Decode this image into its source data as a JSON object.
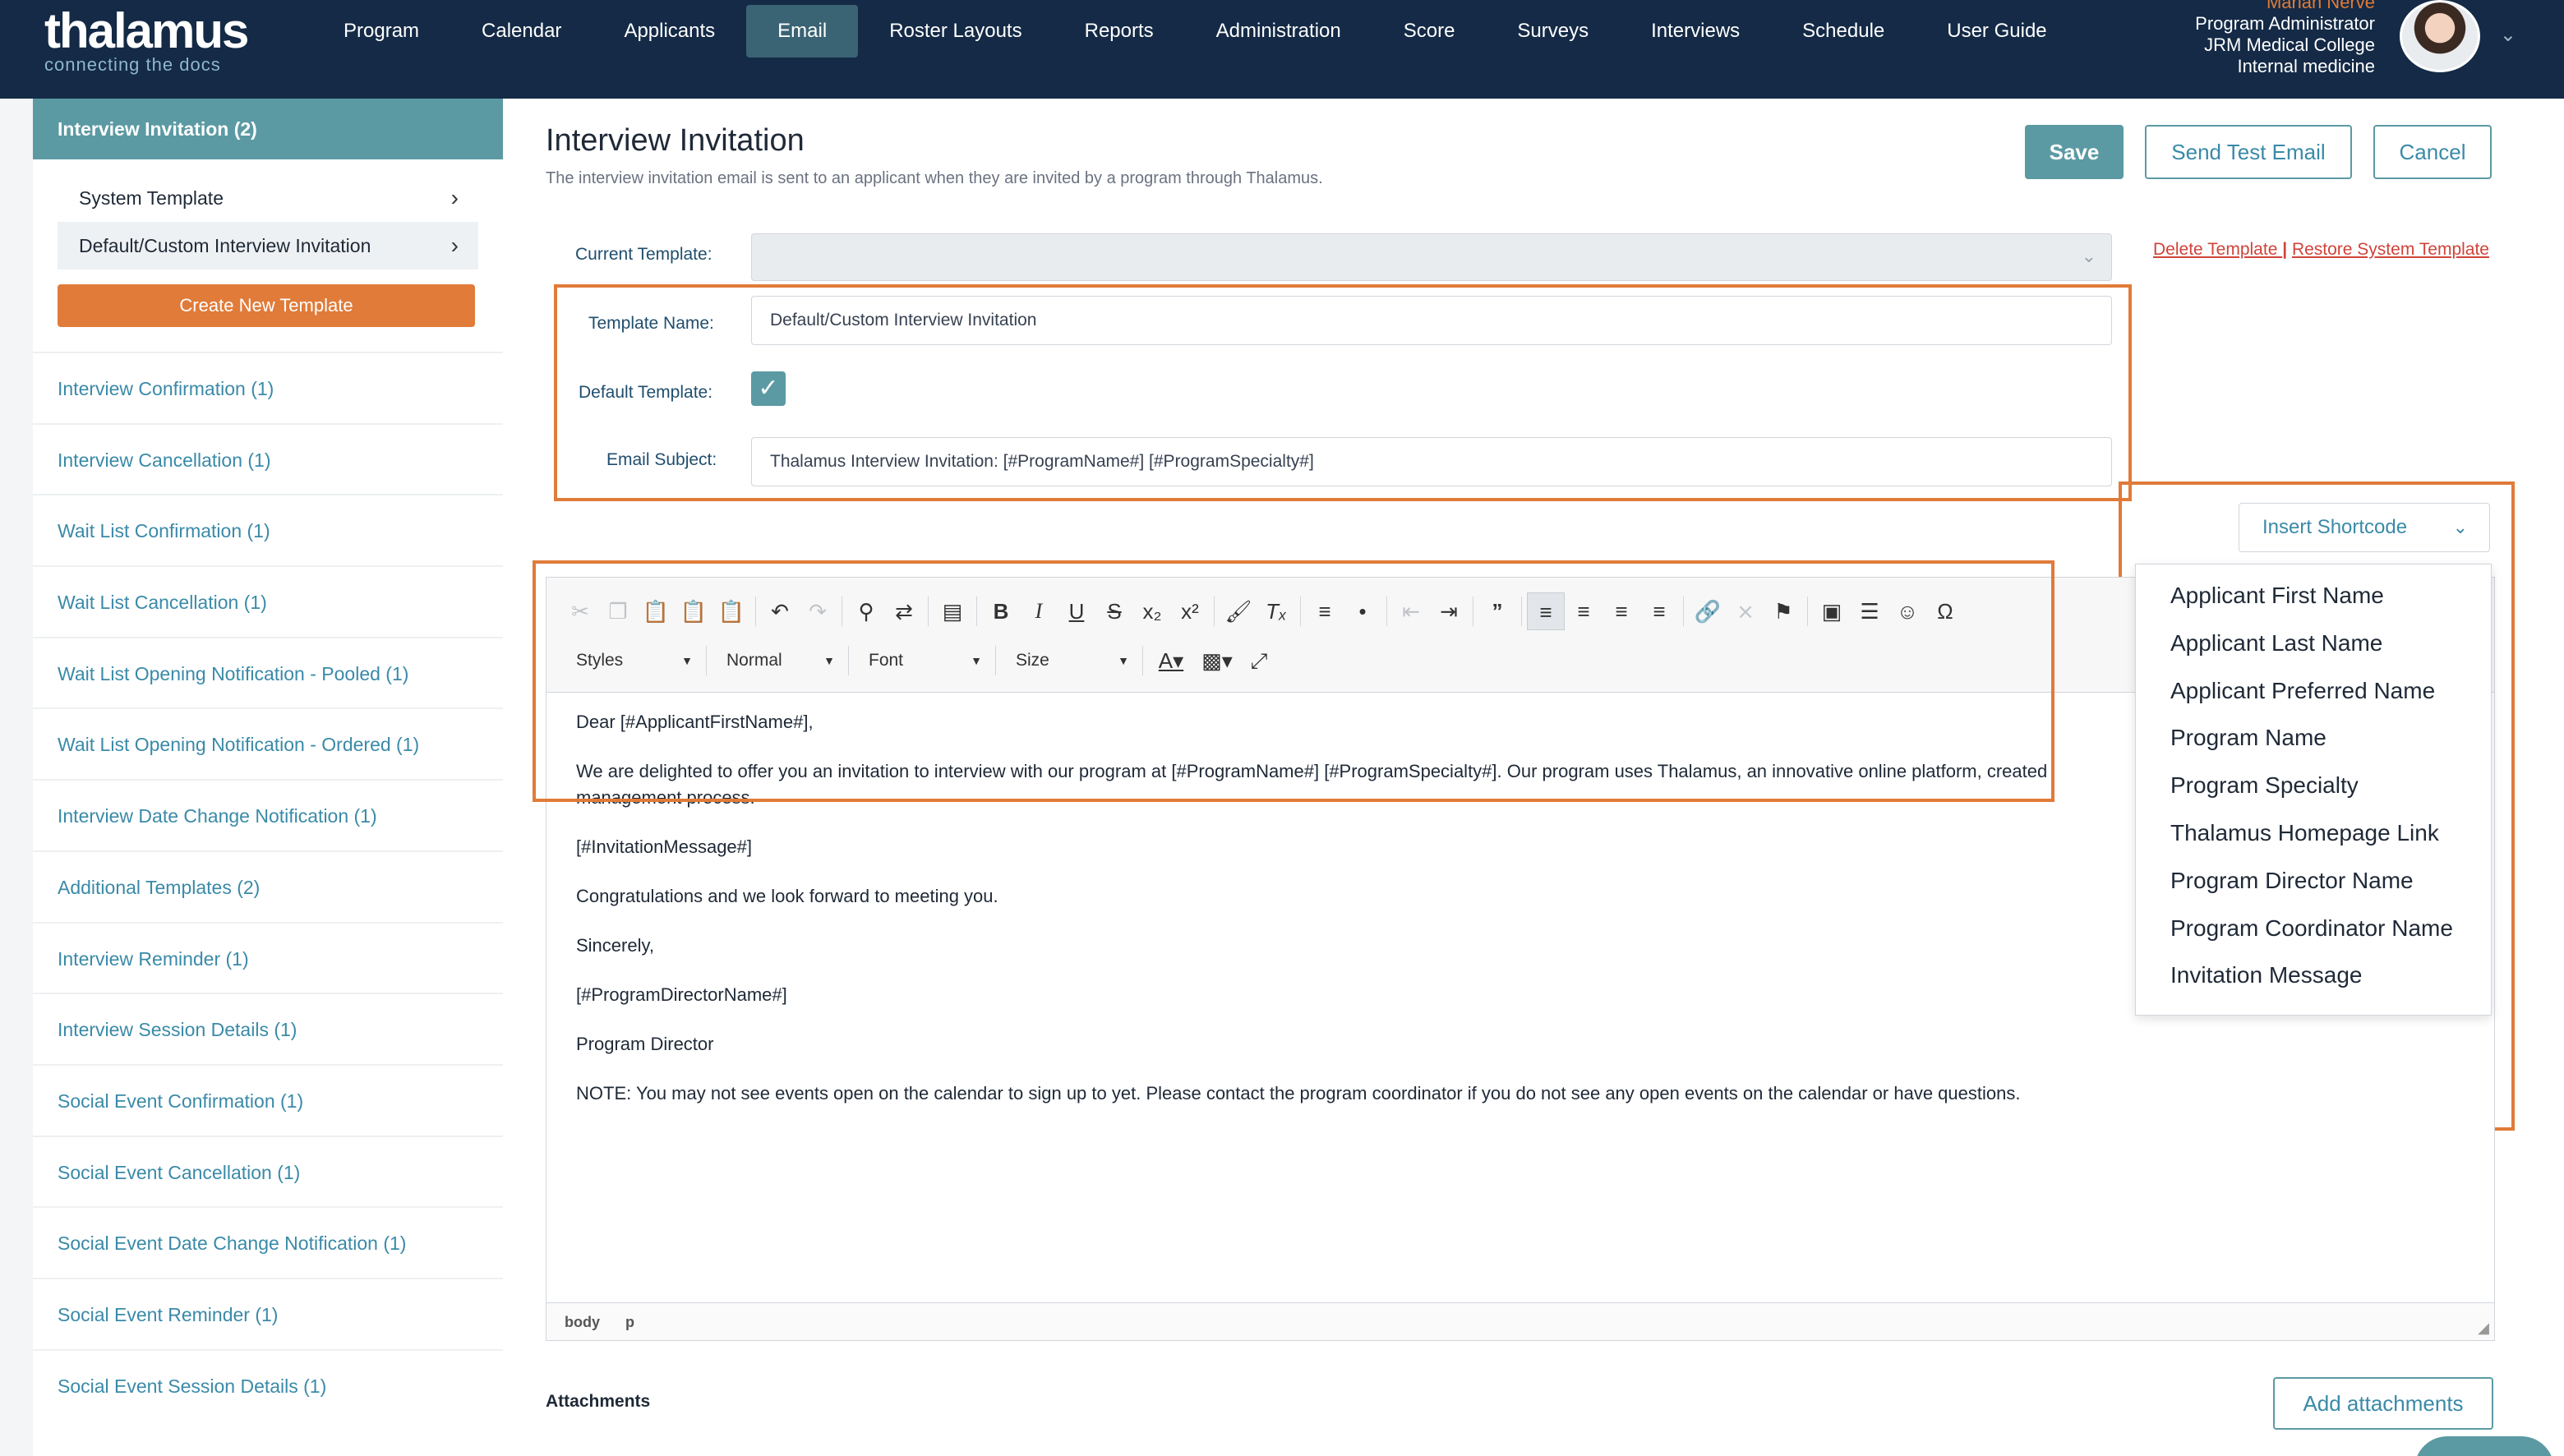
{
  "logo": {
    "main": "thalamus",
    "sub": "connecting the docs"
  },
  "nav": [
    {
      "label": "Program"
    },
    {
      "label": "Calendar"
    },
    {
      "label": "Applicants"
    },
    {
      "label": "Email",
      "active": true
    },
    {
      "label": "Roster Layouts"
    },
    {
      "label": "Reports"
    },
    {
      "label": "Administration"
    },
    {
      "label": "Score"
    },
    {
      "label": "Surveys"
    },
    {
      "label": "Interviews"
    },
    {
      "label": "Schedule"
    },
    {
      "label": "User Guide"
    }
  ],
  "user": {
    "name": "Mariah Nerve",
    "role": "Program Administrator",
    "org": "JRM Medical College",
    "dept": "Internal medicine"
  },
  "sidebar": {
    "header": "Interview Invitation (2)",
    "sub_items": [
      {
        "label": "System Template"
      },
      {
        "label": "Default/Custom Interview Invitation"
      }
    ],
    "create_label": "Create New Template",
    "items": [
      "Interview Confirmation (1)",
      "Interview Cancellation (1)",
      "Wait List Confirmation (1)",
      "Wait List Cancellation (1)",
      "Wait List Opening Notification - Pooled (1)",
      "Wait List Opening Notification - Ordered (1)",
      "Interview Date Change Notification (1)",
      "Additional Templates (2)",
      "Interview Reminder (1)",
      "Interview Session Details (1)",
      "Social Event Confirmation (1)",
      "Social Event Cancellation (1)",
      "Social Event Date Change Notification (1)",
      "Social Event Reminder (1)",
      "Social Event Session Details (1)"
    ]
  },
  "main": {
    "title": "Interview Invitation",
    "description": "The interview invitation email is sent to an applicant when they are invited by a program through Thalamus.",
    "save_label": "Save",
    "send_test_label": "Send Test Email",
    "cancel_label": "Cancel",
    "current_template_label": "Current Template:",
    "current_template_value": "",
    "delete_link": "Delete Template ",
    "link_sep": "|",
    "restore_link": "Restore System Template",
    "template_name_label": "Template Name:",
    "template_name_value": "Default/Custom Interview Invitation",
    "default_template_label": "Default Template:",
    "default_template_checked": true,
    "email_subject_label": "Email Subject:",
    "email_subject_value": "Thalamus Interview Invitation: [#ProgramName#] [#ProgramSpecialty#]",
    "insert_shortcode_label": "Insert Shortcode",
    "shortcodes": [
      "Applicant First Name",
      "Applicant Last Name",
      "Applicant Preferred Name",
      "Program Name",
      "Program Specialty",
      "Thalamus Homepage Link",
      "Program Director Name",
      "Program Coordinator Name",
      "Invitation Message"
    ],
    "attachments_label": "Attachments",
    "add_attachments_label": "Add attachments"
  },
  "editor": {
    "styles_label": "Styles",
    "format_label": "Normal",
    "font_label": "Font",
    "size_label": "Size",
    "body_lines": [
      "Dear [#ApplicantFirstName#],",
      "We are delighted to offer you an invitation to interview with our program at [#ProgramName#] [#ProgramSpecialty#]. Our program uses Thalamus, an innovative online platform, created",
      "management process.",
      "[#InvitationMessage#]",
      "Congratulations and we look forward to meeting you.",
      "Sincerely,",
      "[#ProgramDirectorName#]",
      "Program Director",
      "NOTE: You may not see events open on the calendar to sign up to yet. Please contact the program coordinator if you do not see any open events on the calendar or have questions."
    ],
    "status_path": [
      "body",
      "p"
    ]
  },
  "colors": {
    "navy": "#142a46",
    "teal": "#5b9aa3",
    "orange": "#e07b39",
    "link": "#3a8aa8",
    "danger": "#d0433a"
  }
}
